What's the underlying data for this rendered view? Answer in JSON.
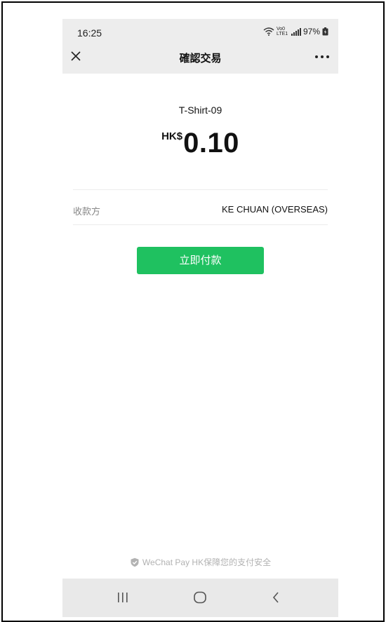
{
  "status_bar": {
    "time": "16:25",
    "network": "Vo0 LTE1",
    "battery": "97%"
  },
  "header": {
    "title": "確認交易",
    "close_icon": "close-icon",
    "more_icon": "more-icon"
  },
  "payment": {
    "merchant": "T-Shirt-09",
    "currency": "HK$",
    "amount": "0.10",
    "payee_label": "收款方",
    "payee_value": "KE CHUAN (OVERSEAS)",
    "pay_button": "立即付款"
  },
  "footer": {
    "security_note": "WeChat Pay HK保障您的支付安全"
  },
  "colors": {
    "accent": "#1fc160",
    "header_bg": "#ededed",
    "navbar_bg": "#e9e9e9"
  }
}
